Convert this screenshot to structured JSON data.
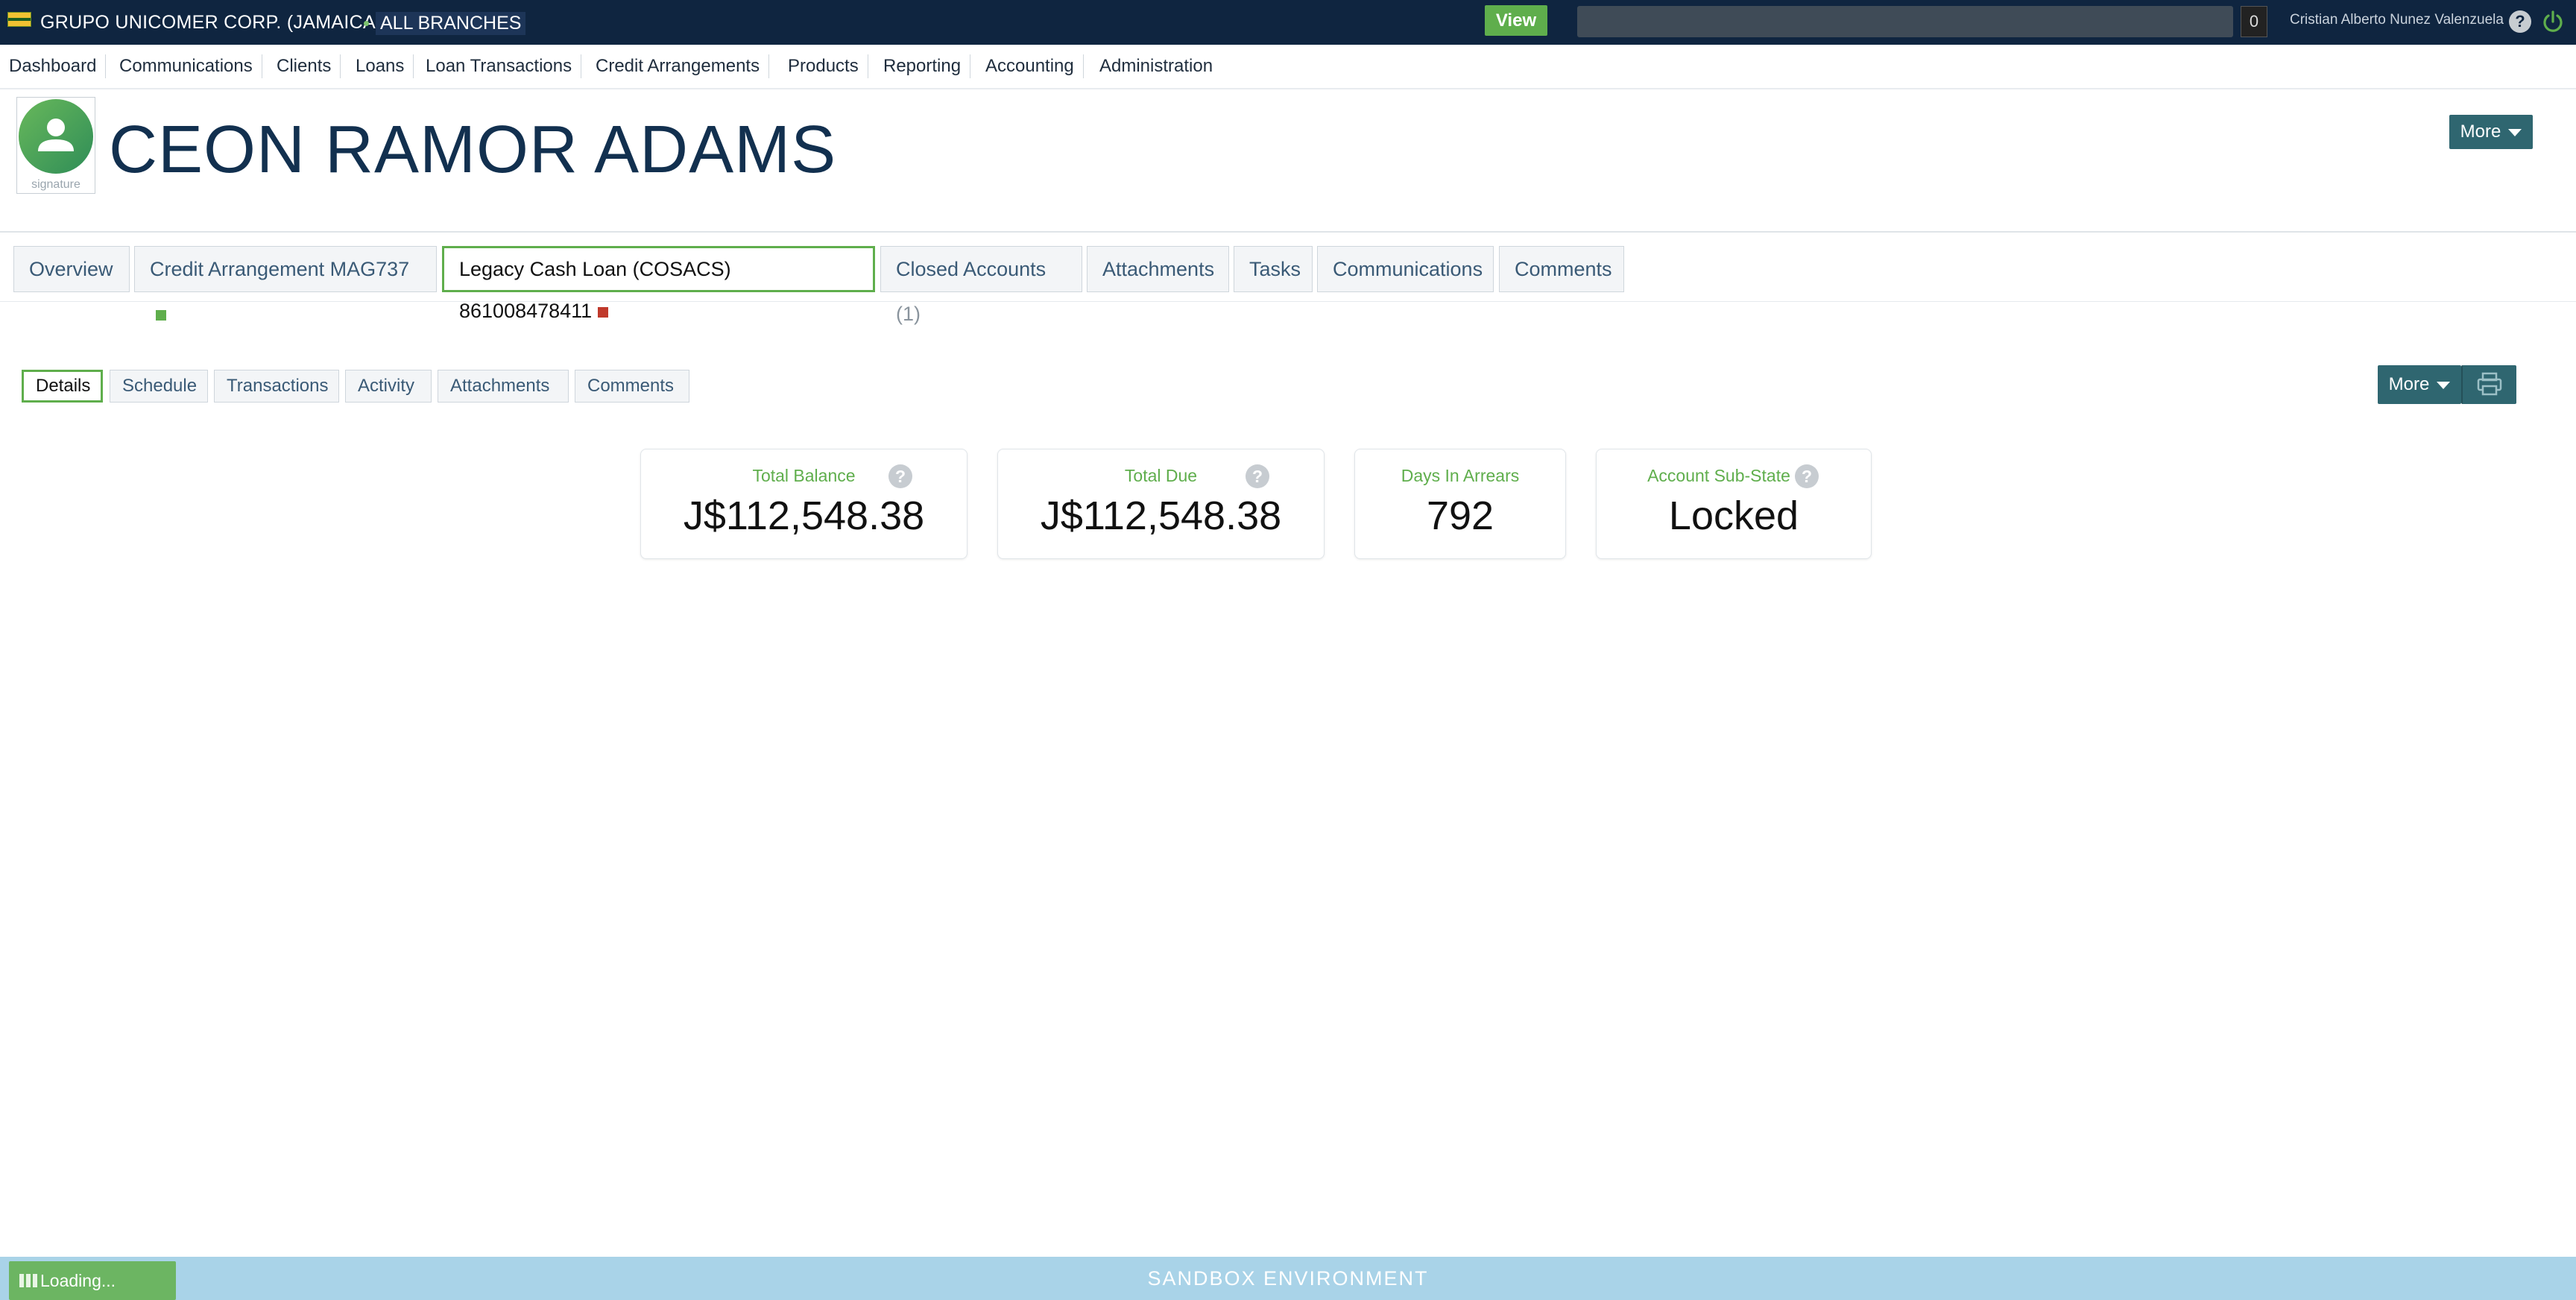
{
  "header": {
    "org_name": "GRUPO UNICOMER CORP. (JAMAICA)",
    "branch": "ALL BRANCHES",
    "view_button": "View",
    "search_value": "",
    "notification_count": "0",
    "user_name": "Cristian Alberto Nunez Valenzuela",
    "help_glyph": "?",
    "icons": [
      "flag-icon",
      "help-icon",
      "power-icon"
    ]
  },
  "nav": {
    "items": [
      "Dashboard",
      "Communications",
      "Clients",
      "Loans",
      "Loan Transactions",
      "Credit Arrangements",
      "Products",
      "Reporting",
      "Accounting",
      "Administration"
    ]
  },
  "client": {
    "name": "CEON RAMOR ADAMS",
    "avatar_caption": "signature",
    "more_label": "More"
  },
  "account_tabs": {
    "overview": "Overview",
    "credit_arrangement": "Credit Arrangement MAG737",
    "legacy_loan": "Legacy Cash Loan (COSACS) 861008478411",
    "closed_accounts": "Closed Accounts",
    "closed_accounts_count": "(1)",
    "attachments": "Attachments",
    "tasks": "Tasks",
    "communications": "Communications",
    "comments": "Comments"
  },
  "sub_tabs": {
    "details": "Details",
    "schedule": "Schedule",
    "transactions": "Transactions",
    "activity": "Activity",
    "attachments": "Attachments",
    "comments": "Comments",
    "more_label": "More"
  },
  "summary": {
    "total_balance_label": "Total Balance",
    "total_balance_value": "J$112,548.38",
    "total_due_label": "Total Due",
    "total_due_value": "J$112,548.38",
    "days_in_arrears_label": "Days In Arrears",
    "days_in_arrears_value": "792",
    "account_substate_label": "Account Sub-State",
    "account_substate_value": "Locked",
    "help_glyph": "?"
  },
  "footer": {
    "environment": "SANDBOX ENVIRONMENT",
    "loading": "Loading..."
  },
  "colors": {
    "header_bg": "#0f2540",
    "accent_green": "#5fae4c",
    "button_teal": "#2f6670",
    "footer_bg": "#a9d3e8",
    "status_red": "#c0392b"
  }
}
